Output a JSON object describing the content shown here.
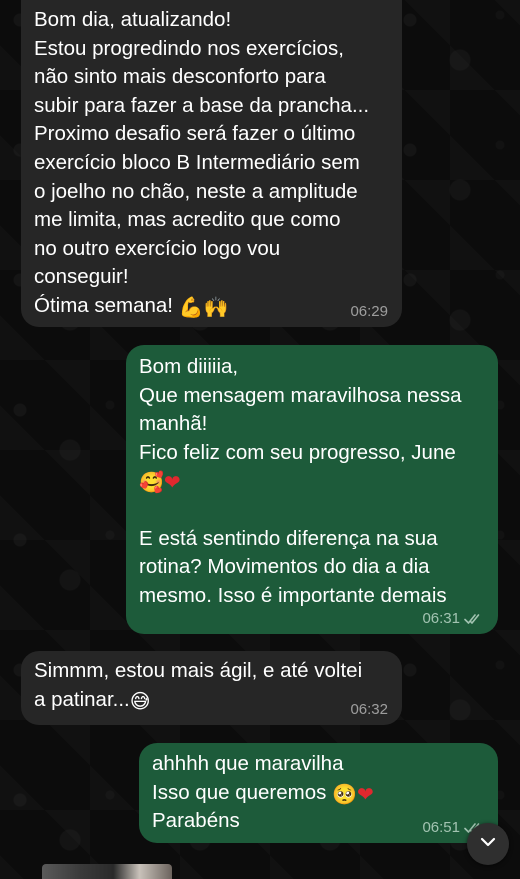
{
  "messages": [
    {
      "direction": "incoming",
      "text": "Bom dia, atualizando!\nEstou progredindo nos exercícios,\nnão sinto mais desconforto para\nsubir para fazer a base da prancha...\nProximo desafio será fazer o último\nexercício bloco B Intermediário sem\no joelho no chão, neste a amplitude\nme limita, mas acredito que como\nno outro exercício logo vou\nconseguir!\nÓtima semana!",
      "emojis": [
        "💪",
        "🙌"
      ],
      "time": "06:29"
    },
    {
      "direction": "outgoing",
      "text": "Bom diiiiia,\nQue mensagem maravilhosa nessa\nmanhã!\nFico feliz com seu progresso, June",
      "emojis": [
        "🥰",
        "❤"
      ],
      "text_after": "E está sentindo diferença na sua\nrotina? Movimentos do dia a dia\nmesmo. Isso é importante demais",
      "time": "06:31",
      "status": "read-double-check"
    },
    {
      "direction": "incoming",
      "text": "Simmm, estou mais ágil, e até voltei\na patinar...",
      "emojis": [
        "😅"
      ],
      "time": "06:32"
    },
    {
      "direction": "outgoing",
      "text_lines": [
        "ahhhh que maravilha",
        "Isso que queremos",
        "Parabéns"
      ],
      "emojis": [
        "🥺",
        "❤"
      ],
      "time": "06:51",
      "status": "read-double-check"
    }
  ],
  "scroll_button": {
    "icon": "chevron-down-icon"
  },
  "colors": {
    "incoming_bubble": "#262626",
    "outgoing_bubble": "#1d5b3a",
    "background": "#0c0c0c"
  }
}
